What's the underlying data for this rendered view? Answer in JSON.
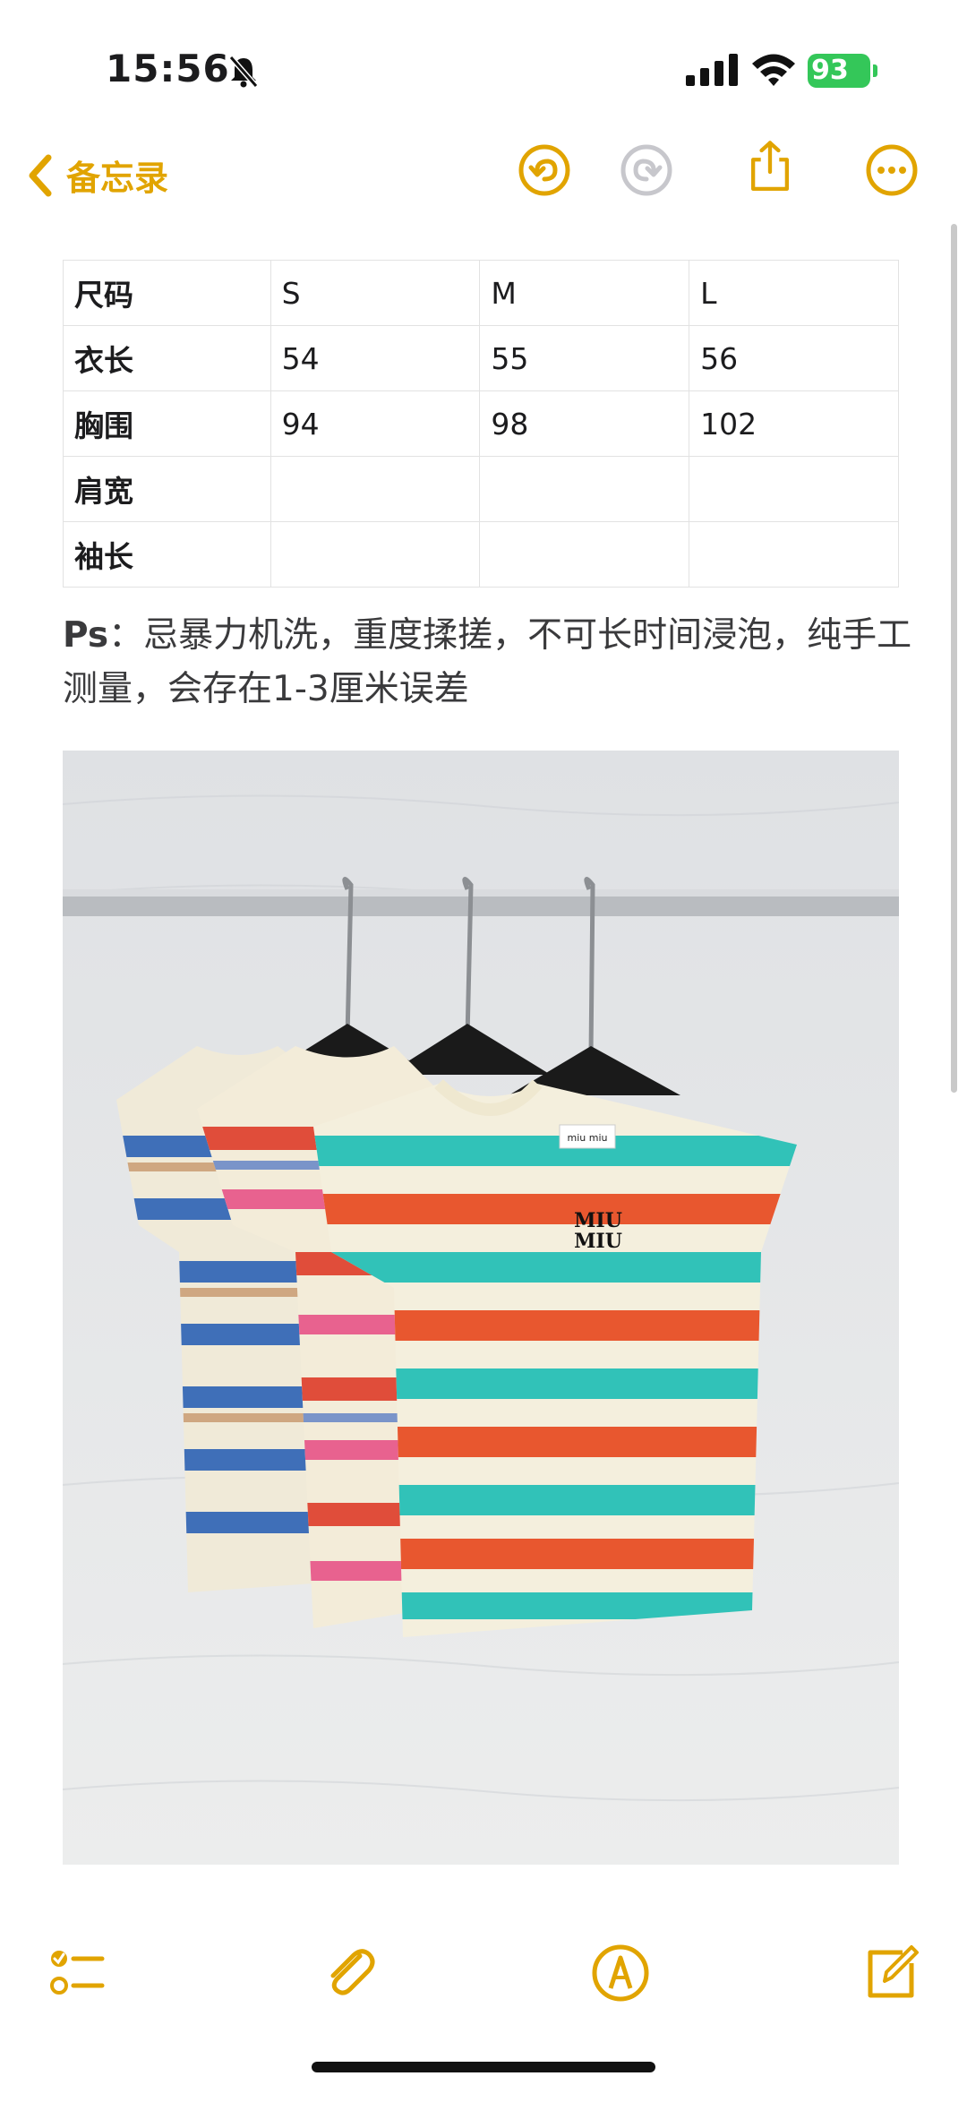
{
  "status": {
    "time": "15:56",
    "battery": "93"
  },
  "nav": {
    "back_label": "备忘录"
  },
  "size_table": {
    "rows": [
      [
        "尺码",
        "S",
        "M",
        "L"
      ],
      [
        "衣长",
        "54",
        "55",
        "56"
      ],
      [
        "胸围",
        "94",
        "98",
        "102"
      ],
      [
        "肩宽",
        "",
        "",
        ""
      ],
      [
        "袖长",
        "",
        "",
        ""
      ]
    ]
  },
  "note": {
    "prefix": "Ps",
    "text": "：忌暴力机洗，重度揉搓，不可长时间浸泡，纯手工测量，会存在1-3厘米误差"
  },
  "photo": {
    "brand_logo": "MIU MIU",
    "stripe_colors": [
      "#3f6fb8",
      "#e04d3a",
      "#31c2b8",
      "#f0ead8"
    ]
  },
  "colors": {
    "accent": "#e1a400",
    "battery": "#34c759"
  },
  "icons": [
    "back-chevron-icon",
    "undo-icon",
    "redo-icon",
    "share-icon",
    "more-icon",
    "checklist-icon",
    "paperclip-icon",
    "markup-pen-icon",
    "compose-icon"
  ]
}
